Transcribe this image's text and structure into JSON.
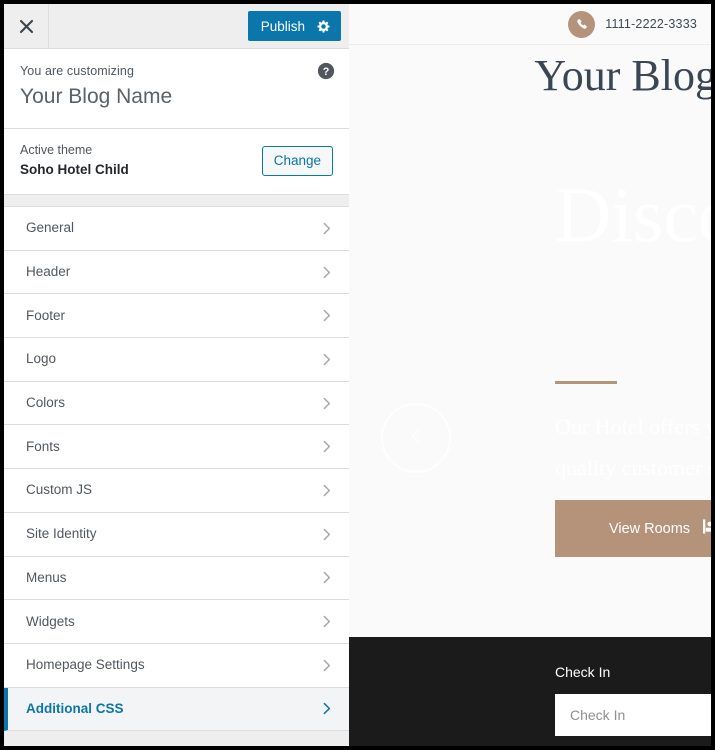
{
  "customizer": {
    "topbar": {
      "close_icon": "close-x-icon",
      "publish_label": "Publish",
      "publish_color": "#0a76ac",
      "settings_icon": "gear-icon"
    },
    "header": {
      "eyebrow": "You are customizing",
      "title": "Your Blog Name",
      "help_icon": "help-circle-icon"
    },
    "theme": {
      "label": "Active theme",
      "name": "Soho Hotel Child",
      "change_label": "Change"
    },
    "sections": [
      {
        "label": "General",
        "active": false
      },
      {
        "label": "Header",
        "active": false
      },
      {
        "label": "Footer",
        "active": false
      },
      {
        "label": "Logo",
        "active": false
      },
      {
        "label": "Colors",
        "active": false
      },
      {
        "label": "Fonts",
        "active": false
      },
      {
        "label": "Custom JS",
        "active": false
      },
      {
        "label": "Site Identity",
        "active": false
      },
      {
        "label": "Menus",
        "active": false
      },
      {
        "label": "Widgets",
        "active": false
      },
      {
        "label": "Homepage Settings",
        "active": false
      },
      {
        "label": "Additional CSS",
        "active": true
      }
    ],
    "chevron_icon": "chevron-right-icon",
    "active_accent": "#0a76ac"
  },
  "preview": {
    "topbar": {
      "phone_icon": "phone-icon",
      "phone_number": "1111-2222-3333",
      "accent": "#b5937a"
    },
    "site_title": "Your Blog",
    "hero": {
      "title": "Disco",
      "subtitle_line1": "Our Hotel offers yo",
      "subtitle_line2": "quality customer se",
      "rule_color": "#b5957a",
      "button_label": "View Rooms",
      "button_icon": "bed-icon",
      "button_color": "#b5937a",
      "prev_arrow_icon": "chevron-left-icon"
    },
    "booking": {
      "check_in_label": "Check In",
      "check_in_placeholder": "Check In",
      "check_in_value": "",
      "background": "#1b1b1b"
    }
  }
}
